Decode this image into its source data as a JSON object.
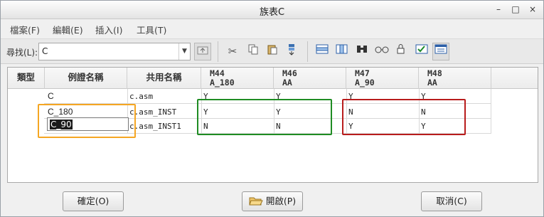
{
  "window": {
    "title": "族表C",
    "controls": [
      "–",
      "□",
      "×"
    ]
  },
  "menu": [
    "檔案(F)",
    "編輯(E)",
    "插入(I)",
    "工具(T)"
  ],
  "toolbar": {
    "search_label": "尋找(L):",
    "search_value": "C",
    "icons": [
      "up-folder-icon",
      "cut-icon",
      "copy-icon",
      "paste-icon",
      "fill-down-icon",
      "insert-row-icon",
      "insert-column-icon",
      "find-icon",
      "verify-icon",
      "lock-icon",
      "check-table-icon",
      "preview-table-icon"
    ]
  },
  "table": {
    "headers": {
      "type": "類型",
      "instance": "例證名稱",
      "common": "共用名稱",
      "c1": [
        "M44",
        "A_180"
      ],
      "c2": [
        "M46",
        "AA"
      ],
      "c3": [
        "M47",
        "A_90"
      ],
      "c4": [
        "M48",
        "AA"
      ]
    },
    "rows": [
      {
        "type": "",
        "instance": "C",
        "common": "c.asm",
        "c1": "Y",
        "c2": "Y",
        "c3": "Y",
        "c4": "Y"
      },
      {
        "type": "",
        "instance": "C_180",
        "common": "c.asm_INST",
        "c1": "Y",
        "c2": "Y",
        "c3": "N",
        "c4": "N"
      },
      {
        "type": "",
        "instance": "C_90",
        "common": "c.asm_INST1",
        "c1": "N",
        "c2": "N",
        "c3": "Y",
        "c4": "Y"
      }
    ]
  },
  "buttons": {
    "ok": "確定(O)",
    "open": "開啟(P)",
    "cancel": "取消(C)"
  },
  "highlight_colors": {
    "orange": "#f5a623",
    "green": "#1f8c23",
    "red": "#b81c1c"
  }
}
